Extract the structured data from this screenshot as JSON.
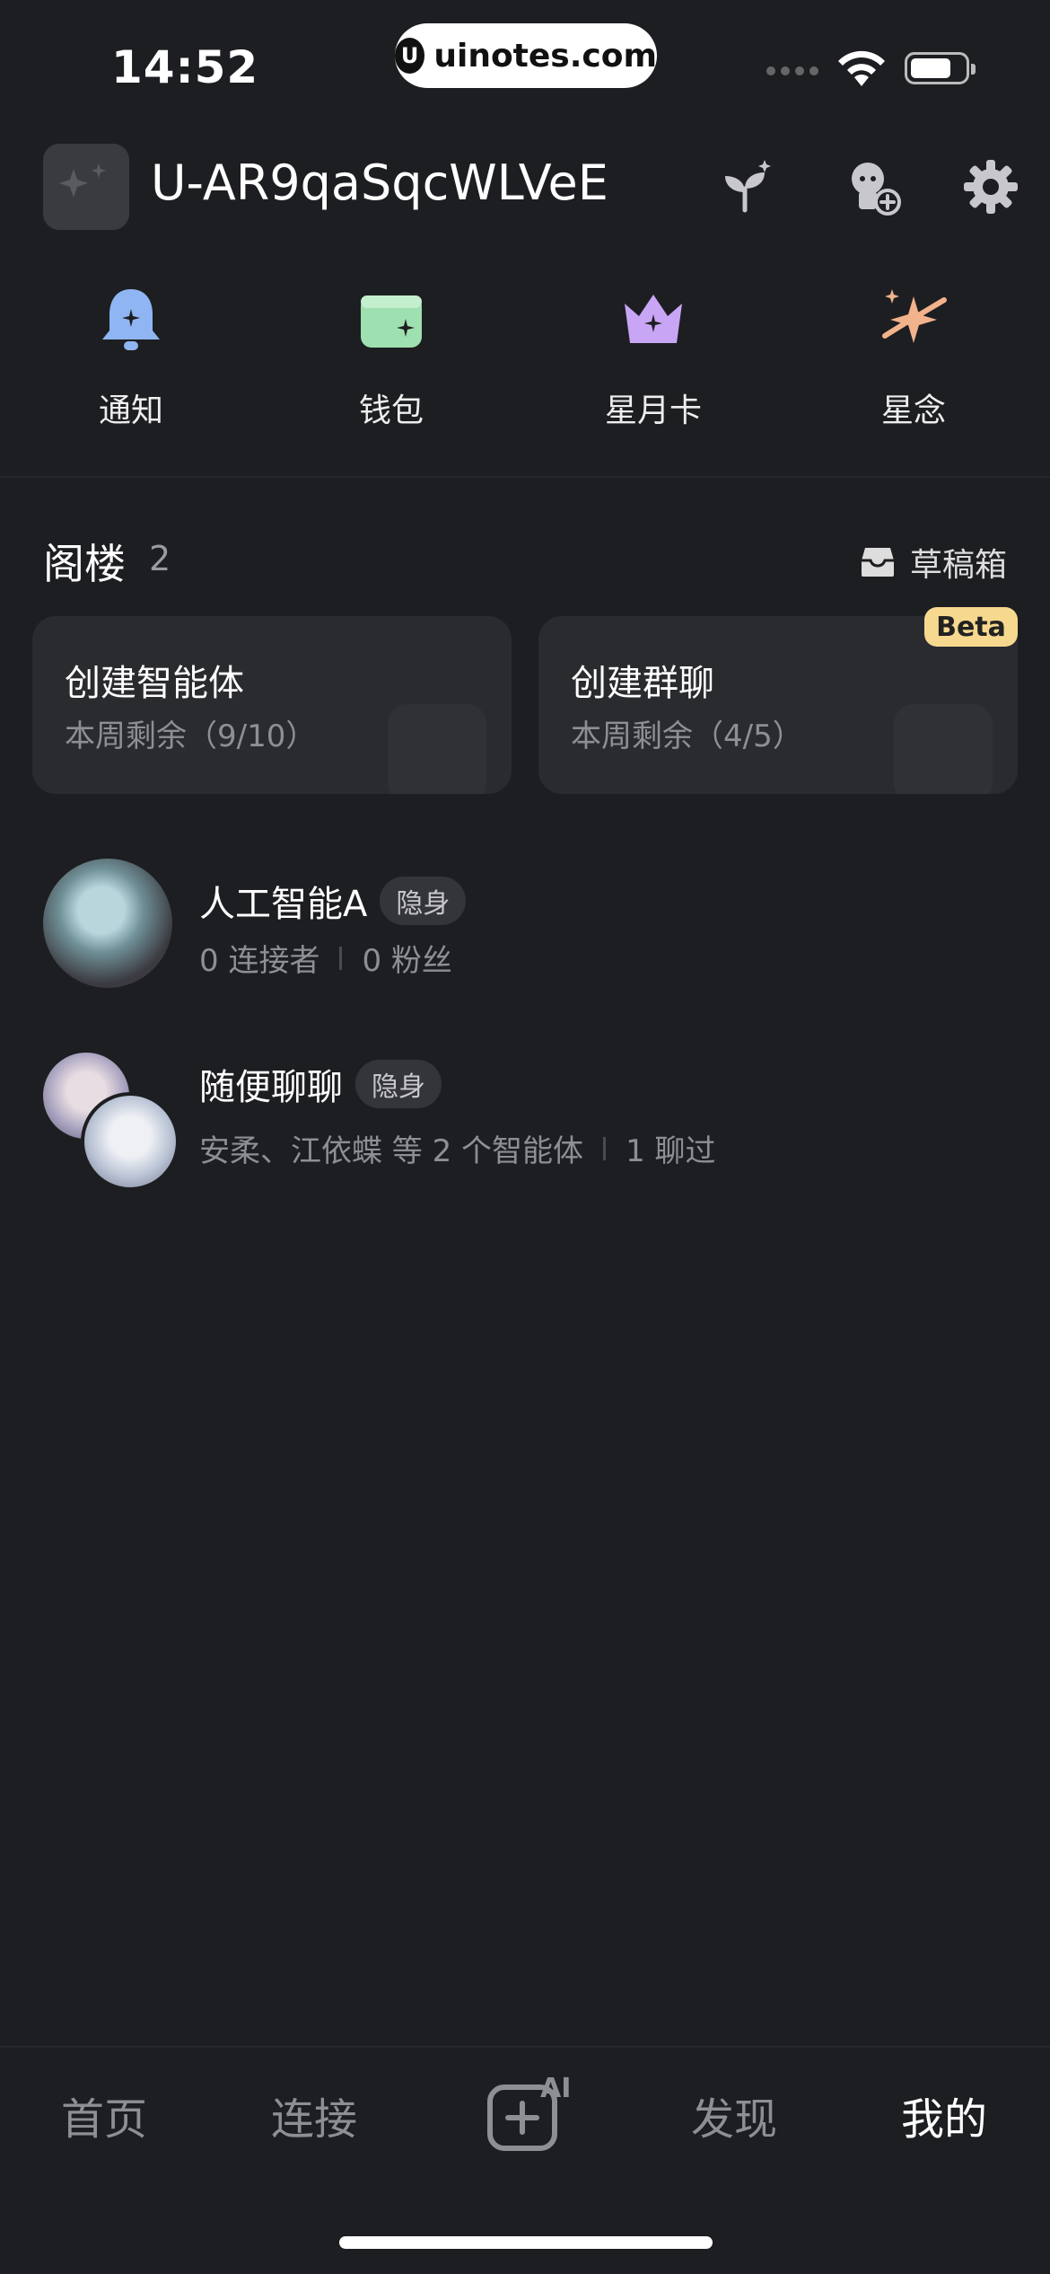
{
  "status_bar": {
    "time": "14:52",
    "url_pill": "uinotes.com",
    "url_logo": "U"
  },
  "header": {
    "username": "U-AR9qaSqcWLVeE",
    "icons": [
      "sprout-sparkle-icon",
      "add-agent-icon",
      "gear-icon"
    ]
  },
  "quick_actions": [
    {
      "label": "通知",
      "icon": "bell-icon",
      "color": "#8fb5f2"
    },
    {
      "label": "钱包",
      "icon": "wallet-icon",
      "color": "#9fe0b0"
    },
    {
      "label": "星月卡",
      "icon": "crown-icon",
      "color": "#c9a6f5"
    },
    {
      "label": "星念",
      "icon": "star-orbit-icon",
      "color": "#f2b28c"
    }
  ],
  "section": {
    "title": "阁楼",
    "count": "2",
    "drafts_label": "草稿箱"
  },
  "cards": [
    {
      "title": "创建智能体",
      "subtitle": "本周剩余（9/10）"
    },
    {
      "title": "创建群聊",
      "subtitle": "本周剩余（4/5）",
      "badge": "Beta"
    }
  ],
  "list": [
    {
      "name": "人工智能A",
      "tag": "隐身",
      "meta1": "0 连接者",
      "meta2": "0 粉丝"
    },
    {
      "name": "随便聊聊",
      "tag": "隐身",
      "meta1": "安柔、江依蝶 等 2 个智能体",
      "meta2": "1 聊过"
    }
  ],
  "tabbar": {
    "items": [
      "首页",
      "连接",
      "发现",
      "我的"
    ],
    "create_ai_label": "AI",
    "active": "我的"
  }
}
